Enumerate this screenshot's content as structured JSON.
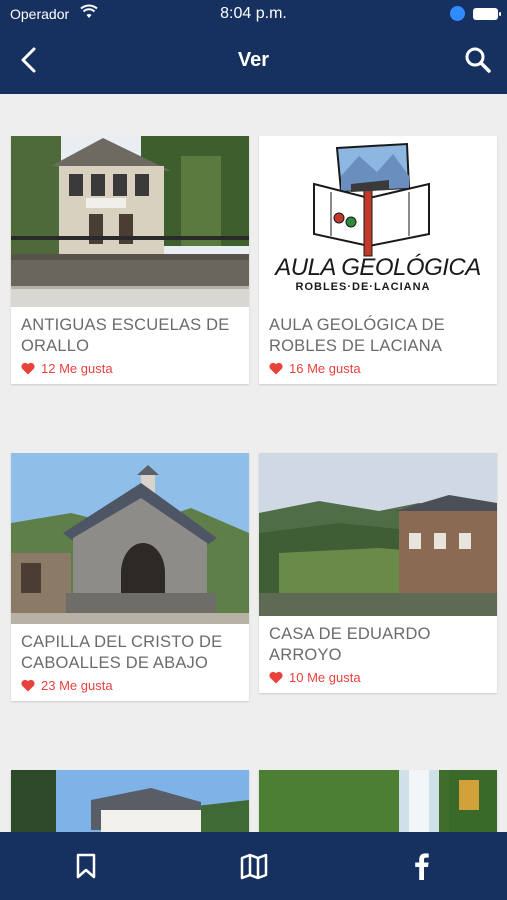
{
  "status_bar": {
    "carrier": "Operador",
    "time": "8:04 p.m."
  },
  "nav": {
    "title": "Ver"
  },
  "cards": [
    {
      "name": "ANTIGUAS ESCUELAS DE ORALLO",
      "likes": "12 Me gusta"
    },
    {
      "name": "AULA GEOLÓGICA DE ROBLES DE LACIANA",
      "likes": "16 Me gusta"
    },
    {
      "name": "CAPILLA DEL CRISTO DE CABOALLES DE ABAJO",
      "likes": "23 Me gusta"
    },
    {
      "name": "CASA DE EDUARDO ARROYO",
      "likes": "10 Me gusta"
    }
  ],
  "logo": {
    "line1": "AULA GEOLÓGICA",
    "line2": "ROBLES·DE·LACIANA"
  },
  "tabs": [
    "bookmark-icon",
    "map-icon",
    "facebook-icon"
  ],
  "colors": {
    "primary": "#16305f",
    "like": "#e8423d",
    "background": "#eeeeee"
  }
}
